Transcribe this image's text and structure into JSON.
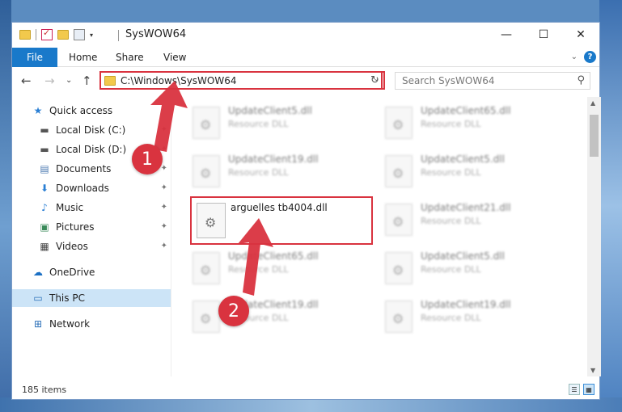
{
  "window": {
    "title": "SysWOW64",
    "controls": {
      "minimize": "—",
      "maximize": "☐",
      "close": "✕"
    }
  },
  "ribbon": {
    "file_tab": "File",
    "tabs": [
      "Home",
      "Share",
      "View"
    ],
    "expand_glyph": "⌄",
    "help_glyph": "?"
  },
  "nav": {
    "back_glyph": "←",
    "forward_glyph": "→",
    "recent_glyph": "⌄",
    "up_glyph": "↑",
    "address": "C:\\Windows\\SysWOW64",
    "address_drop_glyph": "⌄",
    "refresh_glyph": "↻",
    "search_placeholder": "Search SysWOW64",
    "search_glyph": "⚲"
  },
  "sidebar": {
    "items": [
      {
        "label": "Quick access",
        "icon": "star-icon",
        "glyph": "★"
      },
      {
        "label": "Local Disk (C:)",
        "icon": "drive-icon",
        "glyph": "▬",
        "pinned": true
      },
      {
        "label": "Local Disk (D:)",
        "icon": "drive-icon",
        "glyph": "▬",
        "pinned": true
      },
      {
        "label": "Documents",
        "icon": "document-icon",
        "glyph": "▤",
        "pinned": true
      },
      {
        "label": "Downloads",
        "icon": "download-icon",
        "glyph": "⬇",
        "pinned": true
      },
      {
        "label": "Music",
        "icon": "music-icon",
        "glyph": "♪",
        "pinned": true
      },
      {
        "label": "Pictures",
        "icon": "picture-icon",
        "glyph": "▣",
        "pinned": true
      },
      {
        "label": "Videos",
        "icon": "video-icon",
        "glyph": "▦",
        "pinned": true
      },
      {
        "label": "OneDrive",
        "icon": "cloud-icon",
        "glyph": "☁"
      },
      {
        "label": "This PC",
        "icon": "computer-icon",
        "glyph": "▭"
      },
      {
        "label": "Network",
        "icon": "network-icon",
        "glyph": "⊞"
      }
    ],
    "pin_glyph": "✦"
  },
  "files": [
    {
      "name": "UpdateClient5.dll",
      "type": "Resource DLL"
    },
    {
      "name": "UpdateClient65.dll",
      "type": "Resource DLL"
    },
    {
      "name": "UpdateClient19.dll",
      "type": "Resource DLL"
    },
    {
      "name": "UpdateClient5.dll",
      "type": "Resource DLL"
    },
    {
      "name": "UpdateClient21.dll",
      "type": "Resource DLL"
    },
    {
      "name": "UpdateClient65.dll",
      "type": "Resource DLL"
    },
    {
      "name": "UpdateClient5.dll",
      "type": "Resource DLL"
    },
    {
      "name": "UpdateClient19.dll",
      "type": "Resource DLL"
    },
    {
      "name": "UpdateClient19.dll",
      "type": "Resource DLL"
    }
  ],
  "highlighted_file": {
    "name": "arguelles tb4004.dll"
  },
  "status": {
    "count": "185 items"
  },
  "scroll": {
    "up_glyph": "▲",
    "down_glyph": "▼"
  },
  "annotations": {
    "badge1": "1",
    "badge2": "2",
    "accent": "#d9333f"
  }
}
